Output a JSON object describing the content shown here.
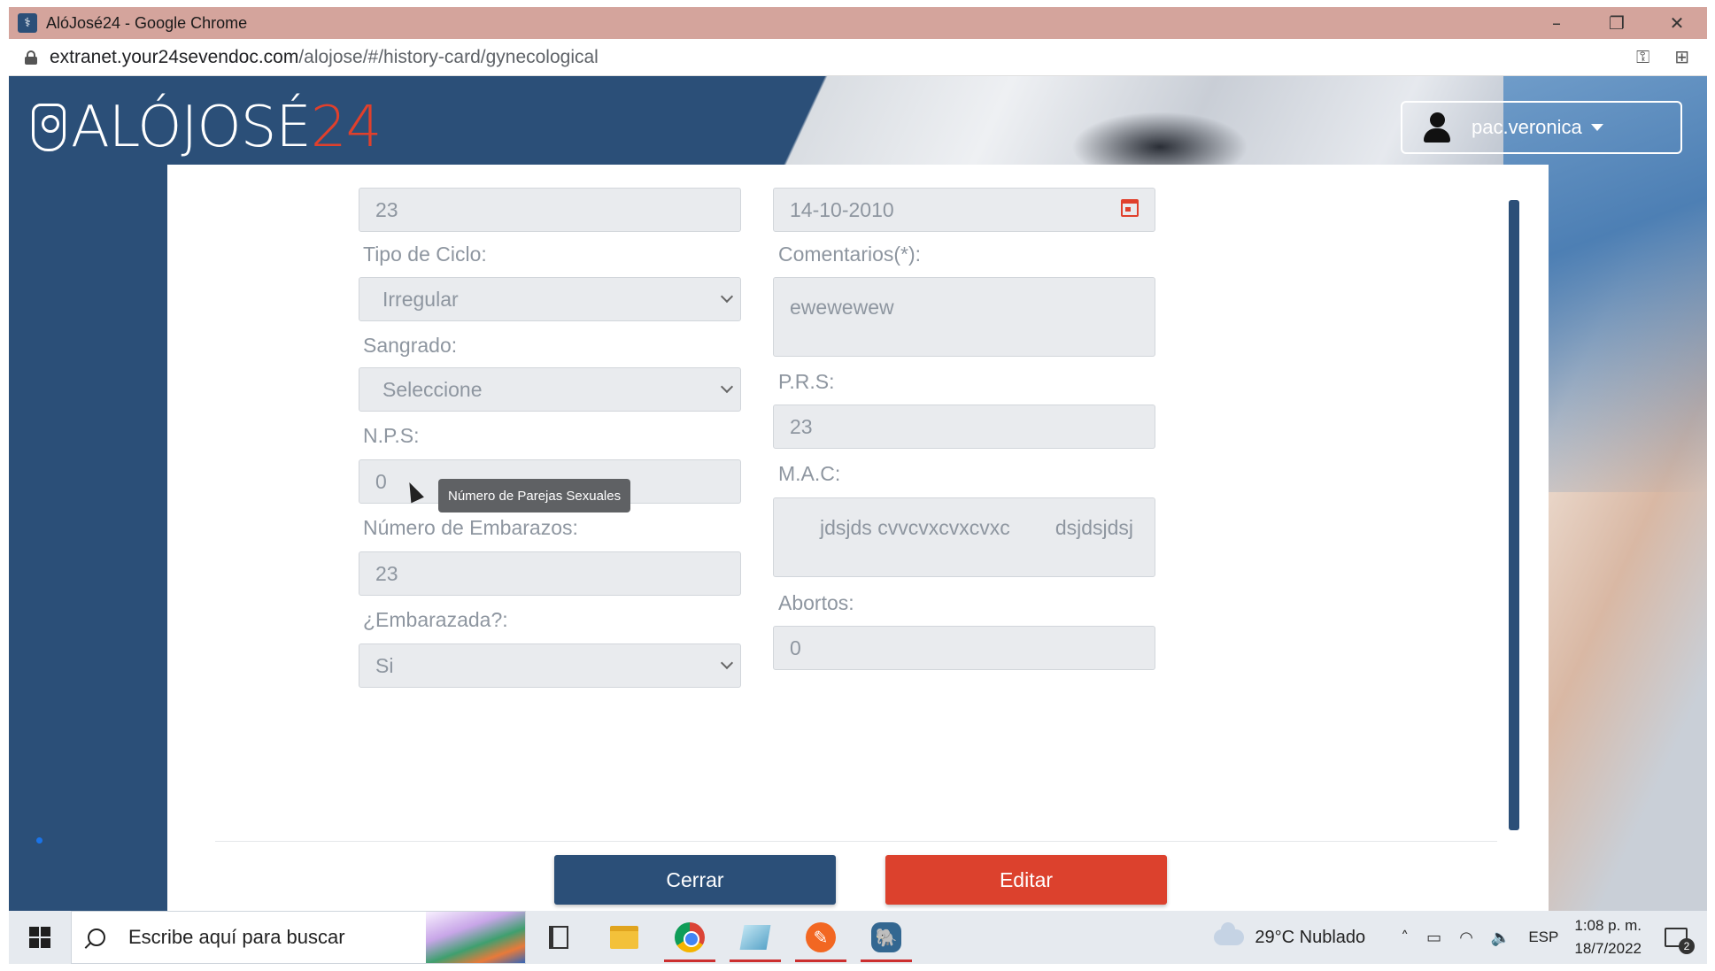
{
  "browser": {
    "window_title": "AlóJosé24 - Google Chrome",
    "url_host": "extranet.your24sevendoc.com",
    "url_path": "/alojose/#/history-card/gynecological",
    "controls": {
      "minimize": "–",
      "restore": "❐",
      "close": "✕"
    }
  },
  "header": {
    "logo_main": "ALÓJOSÉ",
    "logo_accent": "24",
    "user_name": "pac.veronica"
  },
  "form": {
    "left": {
      "value_top": "23",
      "tipo_ciclo_label": "Tipo de Ciclo:",
      "tipo_ciclo_value": "Irregular",
      "sangrado_label": "Sangrado:",
      "sangrado_value": "Seleccione",
      "nps_label": "N.P.S:",
      "nps_value": "0",
      "embarazos_label": "Número de Embarazos:",
      "embarazos_value": "23",
      "embarazada_label": "¿Embarazada?:",
      "embarazada_value": "Si"
    },
    "right": {
      "date_value": "14-10-2010",
      "comentarios_label": "Comentarios(*):",
      "comentarios_value": "ewewewew",
      "prs_label": "P.R.S:",
      "prs_value": "23",
      "mac_label": "M.A.C:",
      "mac_value": "jdsjds cvvcvxcvxcvxc        dsjdsjdsj",
      "abortos_label": "Abortos:",
      "abortos_value": "0"
    },
    "tooltip": "Número de Parejas Sexuales",
    "buttons": {
      "close": "Cerrar",
      "edit": "Editar"
    }
  },
  "taskbar": {
    "search_placeholder": "Escribe aquí para buscar",
    "weather": "29°C  Nublado",
    "language": "ESP",
    "time": "1:08 p. m.",
    "date": "18/7/2022",
    "notification_count": "2"
  },
  "colors": {
    "brand_blue": "#2b4f78",
    "brand_red": "#dc412d",
    "title_bar": "#d4a49c"
  }
}
